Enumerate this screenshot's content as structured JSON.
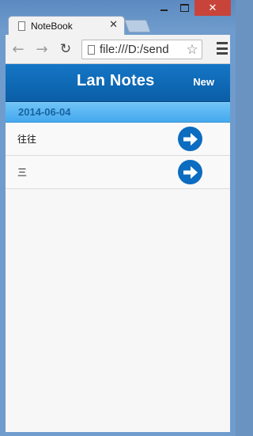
{
  "browser": {
    "tab_title": "NoteBook",
    "tab_close": "✕",
    "url": "file:///D:/send",
    "window_controls": {
      "close": "✕"
    }
  },
  "app": {
    "title": "Lan Notes",
    "new_label": "New",
    "date_divider": "2014-06-04",
    "notes": [
      {
        "text": "往往"
      },
      {
        "text": "三"
      }
    ],
    "colors": {
      "header": "#0b5ea6",
      "divider": "#45a9ee",
      "arrow_button": "#0b6cc0"
    }
  },
  "icons": {
    "back": "←",
    "forward": "→",
    "reload": "↻",
    "star": "☆"
  }
}
